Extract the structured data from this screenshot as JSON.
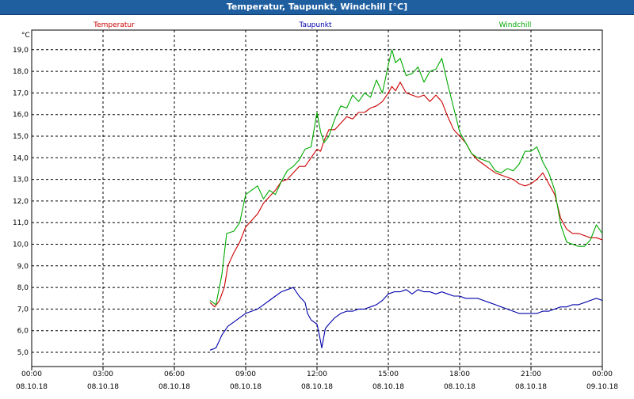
{
  "window": {
    "title": "Temperatur, Taupunkt, Windchill [°C]"
  },
  "chart_data": {
    "type": "line",
    "title": "Temperatur, Taupunkt, Windchill [°C]",
    "ylabel": "°C",
    "ylim": [
      4.5,
      19.5
    ],
    "xlim_hours": [
      0,
      24
    ],
    "grid": true,
    "legend_position": "top",
    "y_ticks": [
      "5,0",
      "6,0",
      "7,0",
      "8,0",
      "9,0",
      "10,0",
      "11,0",
      "12,0",
      "13,0",
      "14,0",
      "15,0",
      "16,0",
      "17,0",
      "18,0",
      "19,0"
    ],
    "x_ticks": [
      {
        "time": "00:00",
        "date": "08.10.18"
      },
      {
        "time": "03:00",
        "date": "08.10.18"
      },
      {
        "time": "06:00",
        "date": "08.10.18"
      },
      {
        "time": "09:00",
        "date": "08.10.18"
      },
      {
        "time": "12:00",
        "date": "08.10.18"
      },
      {
        "time": "15:00",
        "date": "08.10.18"
      },
      {
        "time": "18:00",
        "date": "08.10.18"
      },
      {
        "time": "21:00",
        "date": "08.10.18"
      },
      {
        "time": "00:00",
        "date": "09.10.18"
      }
    ],
    "series": [
      {
        "name": "Temperatur",
        "color": "#cc0000",
        "points": [
          [
            7.5,
            7.3
          ],
          [
            7.7,
            7.1
          ],
          [
            7.9,
            7.4
          ],
          [
            8.1,
            8.0
          ],
          [
            8.25,
            9.0
          ],
          [
            8.5,
            9.6
          ],
          [
            8.75,
            10.1
          ],
          [
            9.0,
            10.8
          ],
          [
            9.25,
            11.1
          ],
          [
            9.5,
            11.4
          ],
          [
            9.75,
            11.9
          ],
          [
            10.0,
            12.2
          ],
          [
            10.25,
            12.5
          ],
          [
            10.5,
            12.9
          ],
          [
            10.75,
            13.0
          ],
          [
            11.0,
            13.3
          ],
          [
            11.25,
            13.6
          ],
          [
            11.5,
            13.6
          ],
          [
            11.75,
            14.0
          ],
          [
            12.0,
            14.4
          ],
          [
            12.15,
            14.3
          ],
          [
            12.3,
            14.8
          ],
          [
            12.5,
            15.3
          ],
          [
            12.75,
            15.3
          ],
          [
            13.0,
            15.6
          ],
          [
            13.25,
            15.9
          ],
          [
            13.5,
            15.8
          ],
          [
            13.75,
            16.1
          ],
          [
            14.0,
            16.1
          ],
          [
            14.25,
            16.3
          ],
          [
            14.5,
            16.4
          ],
          [
            14.75,
            16.6
          ],
          [
            15.0,
            17.0
          ],
          [
            15.15,
            17.3
          ],
          [
            15.3,
            17.1
          ],
          [
            15.5,
            17.5
          ],
          [
            15.75,
            17.0
          ],
          [
            16.0,
            16.9
          ],
          [
            16.25,
            16.8
          ],
          [
            16.5,
            16.9
          ],
          [
            16.75,
            16.6
          ],
          [
            17.0,
            16.9
          ],
          [
            17.25,
            16.6
          ],
          [
            17.5,
            15.9
          ],
          [
            17.75,
            15.3
          ],
          [
            18.0,
            15.0
          ],
          [
            18.25,
            14.7
          ],
          [
            18.5,
            14.2
          ],
          [
            18.75,
            13.9
          ],
          [
            19.0,
            13.7
          ],
          [
            19.25,
            13.5
          ],
          [
            19.5,
            13.3
          ],
          [
            19.75,
            13.2
          ],
          [
            20.0,
            13.1
          ],
          [
            20.25,
            13.0
          ],
          [
            20.5,
            12.8
          ],
          [
            20.75,
            12.7
          ],
          [
            21.0,
            12.8
          ],
          [
            21.25,
            13.0
          ],
          [
            21.5,
            13.3
          ],
          [
            21.75,
            12.8
          ],
          [
            22.0,
            12.3
          ],
          [
            22.25,
            11.2
          ],
          [
            22.5,
            10.7
          ],
          [
            22.75,
            10.5
          ],
          [
            23.0,
            10.5
          ],
          [
            23.25,
            10.4
          ],
          [
            23.5,
            10.3
          ],
          [
            23.75,
            10.3
          ],
          [
            24.0,
            10.2
          ]
        ]
      },
      {
        "name": "Taupunkt",
        "color": "#0000aa",
        "points": [
          [
            7.5,
            5.1
          ],
          [
            7.75,
            5.2
          ],
          [
            8.0,
            5.8
          ],
          [
            8.25,
            6.2
          ],
          [
            8.5,
            6.4
          ],
          [
            8.75,
            6.6
          ],
          [
            9.0,
            6.8
          ],
          [
            9.25,
            6.9
          ],
          [
            9.5,
            7.0
          ],
          [
            9.75,
            7.2
          ],
          [
            10.0,
            7.4
          ],
          [
            10.25,
            7.6
          ],
          [
            10.5,
            7.8
          ],
          [
            10.75,
            7.9
          ],
          [
            11.0,
            8.0
          ],
          [
            11.25,
            7.6
          ],
          [
            11.5,
            7.3
          ],
          [
            11.6,
            6.8
          ],
          [
            11.75,
            6.5
          ],
          [
            12.0,
            6.3
          ],
          [
            12.1,
            5.8
          ],
          [
            12.2,
            5.2
          ],
          [
            12.35,
            6.1
          ],
          [
            12.5,
            6.3
          ],
          [
            12.75,
            6.6
          ],
          [
            13.0,
            6.8
          ],
          [
            13.25,
            6.9
          ],
          [
            13.5,
            6.9
          ],
          [
            13.75,
            7.0
          ],
          [
            14.0,
            7.0
          ],
          [
            14.25,
            7.1
          ],
          [
            14.5,
            7.2
          ],
          [
            14.75,
            7.4
          ],
          [
            15.0,
            7.7
          ],
          [
            15.25,
            7.8
          ],
          [
            15.5,
            7.8
          ],
          [
            15.75,
            7.9
          ],
          [
            16.0,
            7.7
          ],
          [
            16.25,
            7.9
          ],
          [
            16.5,
            7.8
          ],
          [
            16.75,
            7.8
          ],
          [
            17.0,
            7.7
          ],
          [
            17.25,
            7.8
          ],
          [
            17.5,
            7.7
          ],
          [
            17.75,
            7.6
          ],
          [
            18.0,
            7.6
          ],
          [
            18.25,
            7.5
          ],
          [
            18.5,
            7.5
          ],
          [
            18.75,
            7.5
          ],
          [
            19.0,
            7.4
          ],
          [
            19.25,
            7.3
          ],
          [
            19.5,
            7.2
          ],
          [
            19.75,
            7.1
          ],
          [
            20.0,
            7.0
          ],
          [
            20.25,
            6.9
          ],
          [
            20.5,
            6.8
          ],
          [
            20.75,
            6.8
          ],
          [
            21.0,
            6.8
          ],
          [
            21.25,
            6.8
          ],
          [
            21.5,
            6.9
          ],
          [
            21.75,
            6.9
          ],
          [
            22.0,
            7.0
          ],
          [
            22.25,
            7.1
          ],
          [
            22.5,
            7.1
          ],
          [
            22.75,
            7.2
          ],
          [
            23.0,
            7.2
          ],
          [
            23.25,
            7.3
          ],
          [
            23.5,
            7.4
          ],
          [
            23.75,
            7.5
          ],
          [
            24.0,
            7.4
          ]
        ]
      },
      {
        "name": "Windchill",
        "color": "#00aa00",
        "points": [
          [
            7.5,
            7.4
          ],
          [
            7.75,
            7.2
          ],
          [
            8.0,
            8.6
          ],
          [
            8.2,
            10.5
          ],
          [
            8.5,
            10.6
          ],
          [
            8.75,
            11.0
          ],
          [
            9.0,
            12.3
          ],
          [
            9.25,
            12.5
          ],
          [
            9.5,
            12.7
          ],
          [
            9.75,
            12.1
          ],
          [
            10.0,
            12.5
          ],
          [
            10.25,
            12.3
          ],
          [
            10.5,
            12.9
          ],
          [
            10.75,
            13.4
          ],
          [
            11.0,
            13.6
          ],
          [
            11.25,
            13.9
          ],
          [
            11.5,
            14.4
          ],
          [
            11.75,
            14.5
          ],
          [
            12.0,
            16.1
          ],
          [
            12.15,
            15.2
          ],
          [
            12.3,
            14.7
          ],
          [
            12.5,
            15.0
          ],
          [
            12.75,
            15.8
          ],
          [
            13.0,
            16.4
          ],
          [
            13.25,
            16.3
          ],
          [
            13.5,
            16.9
          ],
          [
            13.75,
            16.6
          ],
          [
            14.0,
            17.0
          ],
          [
            14.25,
            16.8
          ],
          [
            14.5,
            17.6
          ],
          [
            14.75,
            17.0
          ],
          [
            15.0,
            18.3
          ],
          [
            15.15,
            19.0
          ],
          [
            15.3,
            18.4
          ],
          [
            15.5,
            18.6
          ],
          [
            15.75,
            17.8
          ],
          [
            16.0,
            17.9
          ],
          [
            16.25,
            18.2
          ],
          [
            16.5,
            17.5
          ],
          [
            16.75,
            18.0
          ],
          [
            17.0,
            18.1
          ],
          [
            17.25,
            18.6
          ],
          [
            17.5,
            17.4
          ],
          [
            17.75,
            16.3
          ],
          [
            18.0,
            15.2
          ],
          [
            18.25,
            14.7
          ],
          [
            18.5,
            14.2
          ],
          [
            18.75,
            14.0
          ],
          [
            19.0,
            13.9
          ],
          [
            19.25,
            13.8
          ],
          [
            19.5,
            13.4
          ],
          [
            19.75,
            13.3
          ],
          [
            20.0,
            13.5
          ],
          [
            20.25,
            13.4
          ],
          [
            20.5,
            13.7
          ],
          [
            20.75,
            14.3
          ],
          [
            21.0,
            14.3
          ],
          [
            21.25,
            14.5
          ],
          [
            21.5,
            13.8
          ],
          [
            21.75,
            13.3
          ],
          [
            22.0,
            12.5
          ],
          [
            22.25,
            10.9
          ],
          [
            22.5,
            10.1
          ],
          [
            22.75,
            10.0
          ],
          [
            23.0,
            9.9
          ],
          [
            23.25,
            9.9
          ],
          [
            23.5,
            10.2
          ],
          [
            23.75,
            10.9
          ],
          [
            24.0,
            10.5
          ]
        ]
      }
    ]
  }
}
